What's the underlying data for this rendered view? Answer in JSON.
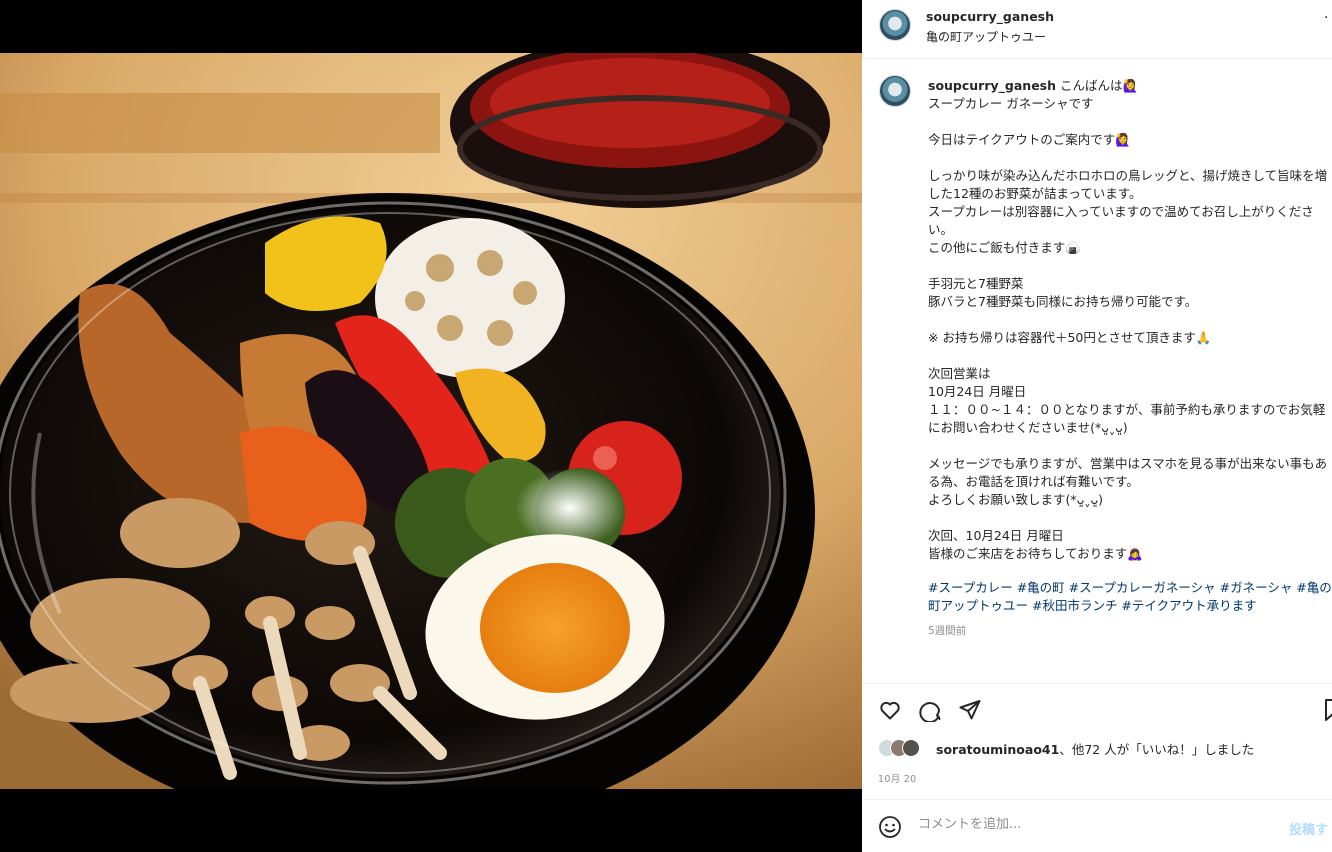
{
  "header": {
    "username": "soupcurry_ganesh",
    "location": "亀の町アップトゥユー",
    "more": "·"
  },
  "caption": {
    "username": "soupcurry_ganesh",
    "text": " こんばんは🙋‍♀️\nスープカレー ガネーシャです\n\n今日はテイクアウトのご案内です🙋‍♀️\n\nしっかり味が染み込んだホロホロの鳥レッグと、揚げ焼きして旨味を増した12種のお野菜が詰まっています。\nスープカレーは別容器に入っていますので温めてお召し上がりください。\nこの他にご飯も付きます🍙\n\n手羽元と7種野菜\n豚バラと7種野菜も同様にお持ち帰り可能です。\n\n※ お持ち帰りは容器代＋50円とさせて頂きます🙏\n\n次回営業は\n10月24日 月曜日\n１１：００~１４：００となりますが、事前予約も承りますのでお気軽にお問い合わせくださいませ(*ᴗ͈ˬᴗ͈)\n\nメッセージでも承りますが、営業中はスマホを見る事が出来ない事もある為、お電話を頂ければ有難いです。\nよろしくお願い致します(*ᴗ͈ˬᴗ͈)\n\n次回、10月24日 月曜日\n皆様のご来店をお待ちしております🙇‍♀️",
    "hashtags": "#スープカレー #亀の町 #スープカレーガネーシャ #ガネーシャ #亀の町アップトゥユー #秋田市ランチ #テイクアウト承ります",
    "time_ago": "5週間前"
  },
  "likes": {
    "user": "soratouminoao41",
    "rest": "、他72 人が「いいね！」しました"
  },
  "date": "10月 20",
  "comment": {
    "placeholder": "コメントを追加...",
    "post_label": "投稿す"
  },
  "colors": {
    "link": "#00376b",
    "post_disabled": "#b3dbff"
  }
}
